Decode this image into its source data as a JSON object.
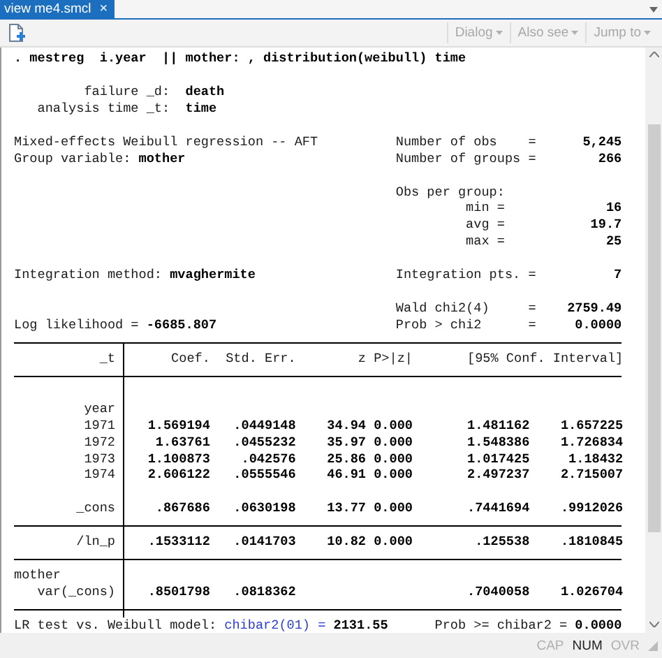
{
  "tab": {
    "title": "view me4.smcl",
    "close": "×"
  },
  "toolbar": {
    "buttons": [
      {
        "label": "Dialog",
        "disabled": true
      },
      {
        "label": "Also see",
        "disabled": true
      },
      {
        "label": "Jump to",
        "disabled": true
      }
    ]
  },
  "command": ". mestreg  i.year  || mother: , distribution(weibull) time",
  "setup": [
    {
      "label": "failure _d:",
      "value": "death"
    },
    {
      "label": "analysis time _t:",
      "value": "time"
    }
  ],
  "header": [
    {
      "kind": "pair",
      "left_label": "Mixed-effects Weibull regression -- AFT",
      "right_label": "Number of obs",
      "eq": "=",
      "value": "5,245"
    },
    {
      "kind": "pair",
      "left_label": "Group variable:",
      "left_value": "mother",
      "right_label": "Number of groups",
      "eq": "=",
      "value": "266"
    },
    {
      "kind": "blank"
    },
    {
      "kind": "pair",
      "right_label": "Obs per group:"
    },
    {
      "kind": "sub",
      "right_label": "min",
      "eq": "=",
      "value": "16"
    },
    {
      "kind": "sub",
      "right_label": "avg",
      "eq": "=",
      "value": "19.7"
    },
    {
      "kind": "sub",
      "right_label": "max",
      "eq": "=",
      "value": "25"
    },
    {
      "kind": "blank"
    },
    {
      "kind": "pair",
      "left_label": "Integration method:",
      "left_value": "mvaghermite",
      "right_label": "Integration pts.",
      "eq": "=",
      "value": "7"
    },
    {
      "kind": "blank"
    },
    {
      "kind": "pair",
      "right_label": "Wald chi2(4)",
      "eq": "=",
      "value": "2759.49"
    },
    {
      "kind": "pair",
      "left_label": "Log likelihood =",
      "left_value": "-6685.807",
      "right_label": "Prob > chi2",
      "eq": "=",
      "value": "0.0000"
    }
  ],
  "table": [
    {
      "kind": "rule"
    },
    {
      "kind": "header",
      "label": "_t",
      "columns": [
        "Coef.",
        "Std. Err.",
        "z",
        "P>|z|",
        "[95% Conf. Interval]"
      ]
    },
    {
      "kind": "rule"
    },
    {
      "kind": "blank"
    },
    {
      "kind": "row",
      "label": "year"
    },
    {
      "kind": "row",
      "label": "1971",
      "cells": [
        "1.569194",
        ".0449148",
        "34.94",
        "0.000",
        "1.481162",
        "1.657225"
      ]
    },
    {
      "kind": "row",
      "label": "1972",
      "cells": [
        "1.63761",
        ".0455232",
        "35.97",
        "0.000",
        "1.548386",
        "1.726834"
      ]
    },
    {
      "kind": "row",
      "label": "1973",
      "cells": [
        "1.100873",
        ".042576",
        "25.86",
        "0.000",
        "1.017425",
        "1.18432"
      ]
    },
    {
      "kind": "row",
      "label": "1974",
      "cells": [
        "2.606122",
        ".0555546",
        "46.91",
        "0.000",
        "2.497237",
        "2.715007"
      ]
    },
    {
      "kind": "blank"
    },
    {
      "kind": "row",
      "label": "_cons",
      "cells": [
        ".867686",
        ".0630198",
        "13.77",
        "0.000",
        ".7441694",
        ".9912026"
      ]
    },
    {
      "kind": "rule"
    },
    {
      "kind": "row",
      "label": "/ln_p",
      "cells": [
        ".1533112",
        ".0141703",
        "10.82",
        "0.000",
        ".125538",
        ".1810845"
      ]
    },
    {
      "kind": "rule"
    },
    {
      "kind": "group",
      "label": "mother"
    },
    {
      "kind": "row",
      "label": "var(_cons)",
      "cells": [
        ".8501798",
        ".0818362",
        "",
        "",
        ".7040058",
        "1.026704"
      ]
    },
    {
      "kind": "rule"
    }
  ],
  "footer": {
    "text": "LR test vs. Weibull model:",
    "link": "chibar2(01) =",
    "value": "2131.55",
    "right_label": "Prob >= chibar2 =",
    "right_value": "0.0000"
  },
  "status": [
    {
      "label": "CAP",
      "on": false
    },
    {
      "label": "NUM",
      "on": true
    },
    {
      "label": "OVR",
      "on": false
    }
  ]
}
